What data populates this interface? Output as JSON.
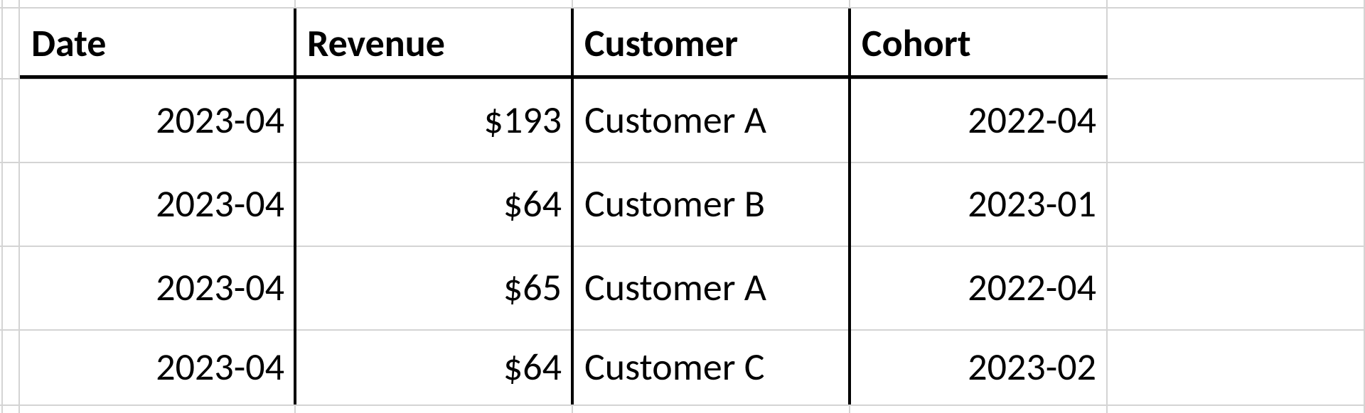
{
  "table": {
    "headers": {
      "date": "Date",
      "revenue": "Revenue",
      "customer": "Customer",
      "cohort": "Cohort"
    },
    "rows": [
      {
        "date": "2023-04",
        "revenue": "$193",
        "customer": "Customer A",
        "cohort": "2022-04"
      },
      {
        "date": "2023-04",
        "revenue": "$64",
        "customer": "Customer B",
        "cohort": "2023-01"
      },
      {
        "date": "2023-04",
        "revenue": "$65",
        "customer": "Customer A",
        "cohort": "2022-04"
      },
      {
        "date": "2023-04",
        "revenue": "$64",
        "customer": "Customer C",
        "cohort": "2023-02"
      }
    ]
  }
}
